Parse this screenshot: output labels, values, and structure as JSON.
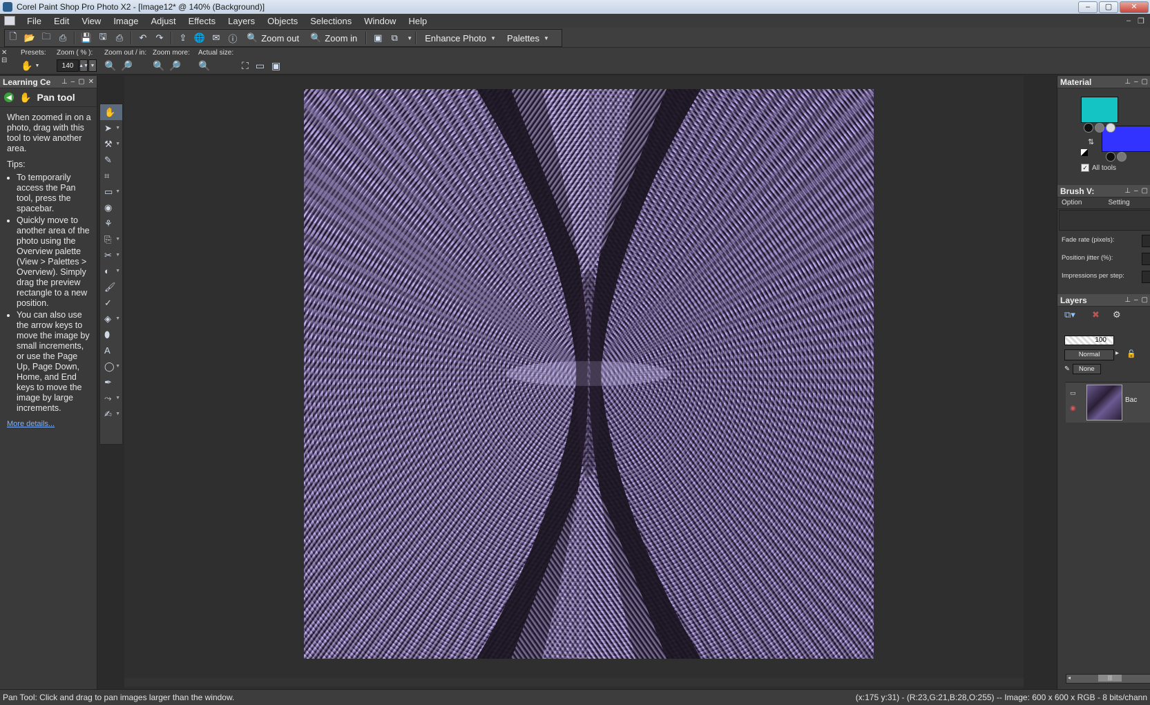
{
  "window": {
    "title": "Corel Paint Shop Pro Photo X2 - [Image12* @ 140% (Background)]",
    "buttons": [
      "–",
      "▢",
      "✕"
    ]
  },
  "menu": [
    "File",
    "Edit",
    "View",
    "Image",
    "Adjust",
    "Effects",
    "Layers",
    "Objects",
    "Selections",
    "Window",
    "Help"
  ],
  "toolbar": {
    "zoom_out_label": "Zoom out",
    "zoom_in_label": "Zoom in",
    "enhance_photo_label": "Enhance Photo",
    "palettes_label": "Palettes"
  },
  "tool_options": {
    "presets_label": "Presets:",
    "zoom_label": "Zoom ( % ):",
    "zoom_value": "140",
    "zoom_out_in_label": "Zoom out / in:",
    "zoom_more_label": "Zoom more:",
    "actual_size_label": "Actual size:"
  },
  "learning_center": {
    "title": "Learning Ce",
    "tool_name": "Pan tool",
    "intro": "When zoomed in on a photo, drag with this tool to view another area.",
    "tips_label": "Tips:",
    "tips": [
      "To temporarily access the Pan tool, press the spacebar.",
      "Quickly move to another area of the photo using the Overview palette (View > Palettes > Overview). Simply drag the preview rectangle to a new position.",
      "You can also use the arrow keys to move the image by small increments, or use the Page Up, Page Down, Home, and End keys to move the image by large increments."
    ],
    "more_details": "More details..."
  },
  "material": {
    "title": "Material",
    "foreground_color": "#14c3c3",
    "background_color": "#3333ff",
    "all_tools_label": "All tools",
    "all_tools_checked": true
  },
  "brush_variance": {
    "title": "Brush V:",
    "tab_option": "Option",
    "tab_setting": "Setting",
    "fade_rate_label": "Fade rate (pixels):",
    "position_jitter_label": "Position jitter (%):",
    "impressions_label": "Impressions per step:"
  },
  "layers": {
    "title": "Layers",
    "opacity_value": "100",
    "blend_mode": "Normal",
    "mask_label": "None",
    "layer_name": "Bac"
  },
  "status": {
    "left": "Pan Tool: Click and drag to pan images larger than the window.",
    "right": "(x:175 y:31) - (R:23,G:21,B:28,O:255) -- Image:  600 x 600 x RGB - 8 bits/chann"
  }
}
